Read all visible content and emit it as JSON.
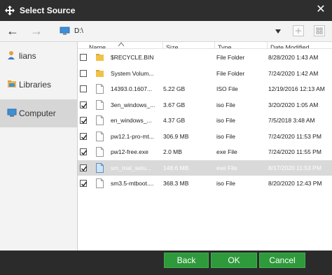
{
  "window": {
    "title": "Select Source"
  },
  "toolbar": {
    "path": "D:\\"
  },
  "sidebar": {
    "items": [
      {
        "label": "lians",
        "icon": "user-icon"
      },
      {
        "label": "Libraries",
        "icon": "library-icon"
      },
      {
        "label": "Computer",
        "icon": "computer-icon",
        "selected": true
      }
    ]
  },
  "columns": [
    "Name",
    "Size",
    "Type",
    "Date Modified"
  ],
  "files": [
    {
      "name": "$RECYCLE.BIN",
      "size": "",
      "type": "File Folder",
      "date": "8/28/2020 1:43 AM",
      "icon": "folder-icon",
      "checked": false,
      "selected": false
    },
    {
      "name": "System Volum...",
      "size": "",
      "type": "File Folder",
      "date": "7/24/2020 1:42 AM",
      "icon": "folder-icon",
      "checked": false,
      "selected": false
    },
    {
      "name": "14393.0.1607...",
      "size": "5.22 GB",
      "type": "ISO File",
      "date": "12/19/2016 12:13 AM",
      "icon": "file-icon",
      "checked": false,
      "selected": false
    },
    {
      "name": "3en_windows_...",
      "size": "3.67 GB",
      "type": "iso File",
      "date": "3/20/2020 1:05 AM",
      "icon": "file-icon",
      "checked": true,
      "selected": false
    },
    {
      "name": "en_windows_...",
      "size": "4.37 GB",
      "type": "iso File",
      "date": "7/5/2018 3:48 AM",
      "icon": "file-icon",
      "checked": true,
      "selected": false
    },
    {
      "name": "pw12.1-pro-mt...",
      "size": "306.9 MB",
      "type": "iso File",
      "date": "7/24/2020 11:53 PM",
      "icon": "file-icon",
      "checked": true,
      "selected": false
    },
    {
      "name": "pw12-free.exe",
      "size": "2.0 MB",
      "type": "exe File",
      "date": "7/24/2020 11:55 PM",
      "icon": "file-icon",
      "checked": true,
      "selected": false
    },
    {
      "name": "sm_trial_setu...",
      "size": "148.6 MB",
      "type": "exe File",
      "date": "8/17/2020 11:53 PM",
      "icon": "file-icon-blue",
      "checked": true,
      "selected": true
    },
    {
      "name": "sm3.5-mtboot....",
      "size": "368.3 MB",
      "type": "iso File",
      "date": "8/20/2020 12:43 PM",
      "icon": "file-icon",
      "checked": true,
      "selected": false
    }
  ],
  "buttons": {
    "back": "Back",
    "ok": "OK",
    "cancel": "Cancel"
  },
  "colors": {
    "accent_green": "#2f9a3b",
    "title_bg": "#2e2e2e",
    "selection": "#d9d9d9"
  }
}
